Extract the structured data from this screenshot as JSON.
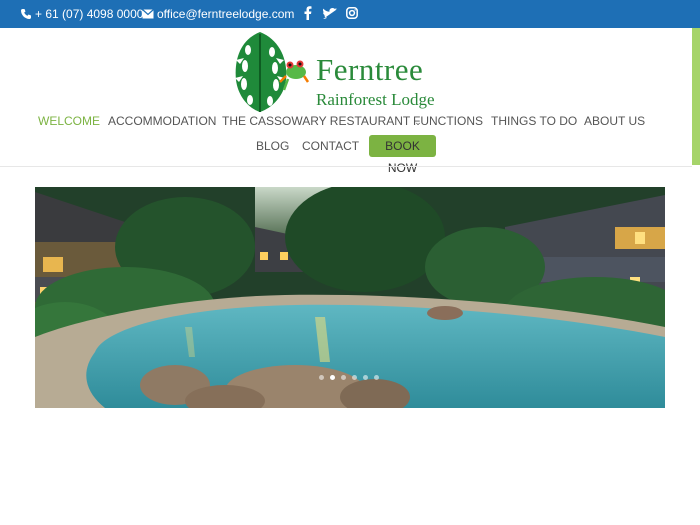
{
  "topbar": {
    "phone": "+ 61 (07) 4098 0000",
    "email": "office@ferntreelodge.com",
    "icons": [
      "phone-icon",
      "mail-icon",
      "facebook-icon",
      "twitter-icon",
      "instagram-icon"
    ],
    "color": "#1e6fb5"
  },
  "brand": {
    "name_line1": "Ferntree",
    "name_line2": "Rainforest Lodge",
    "color": "#2a8a3a"
  },
  "nav": {
    "items": [
      {
        "label": "WELCOME",
        "active": true
      },
      {
        "label": "ACCOMMODATION"
      },
      {
        "label": "THE CASSOWARY RESTAURANT"
      },
      {
        "label": "FUNCTIONS"
      },
      {
        "label": "THINGS TO DO"
      },
      {
        "label": "ABOUT US"
      },
      {
        "label": "BLOG"
      },
      {
        "label": "CONTACT"
      }
    ],
    "book_label": "BOOK NOW",
    "accent": "#7cb342"
  },
  "slider": {
    "slide_count": 6,
    "active_index": 1
  }
}
